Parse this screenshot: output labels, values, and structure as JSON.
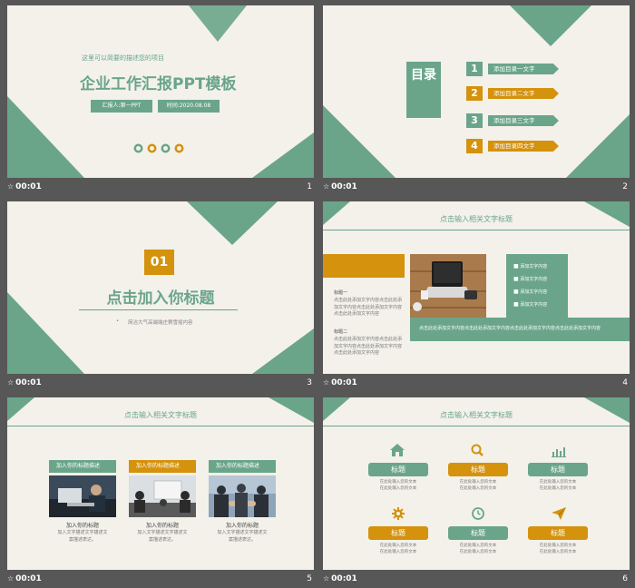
{
  "slides": [
    {
      "number": "1",
      "time": "00:01",
      "subtitle": "这里可以简要的描述您的项目",
      "title": "企业工作汇报PPT模板",
      "presenter": "汇报人:第一PPT",
      "date": "时间:2020.08.08"
    },
    {
      "number": "2",
      "time": "00:01",
      "toc_label": "目录",
      "items": [
        {
          "num": "1",
          "text": "添加目录一文字"
        },
        {
          "num": "2",
          "text": "添加目录二文字"
        },
        {
          "num": "3",
          "text": "添加目录三文字"
        },
        {
          "num": "4",
          "text": "添加目录四文字"
        }
      ]
    },
    {
      "number": "3",
      "time": "00:01",
      "section_num": "01",
      "title": "点击加入你标题",
      "desc": "简洁大气高端端庄赛雪插内容"
    },
    {
      "number": "4",
      "time": "00:01",
      "header": "点击输入相关文字标题",
      "label1": "标题一",
      "text1": "点击此处添加文字内容点击此处添加文字内容点击此处添加文字内容点击此处添加文字内容",
      "label2": "标题二",
      "text2": "点击此处添加文字内容点击此处添加文字内容点击此处添加文字内容点击此处添加文字内容",
      "bullets": [
        "添加文字内容",
        "添加文字内容",
        "添加文字内容",
        "添加文字内容"
      ],
      "bottom_text": "点击此处添加文字内容点击此处添加文字内容点击此处添加文字内容点击此处添加文字内容"
    },
    {
      "number": "5",
      "time": "00:01",
      "header": "点击输入相关文字标题",
      "cards": [
        {
          "label": "加入你的标题描述",
          "caption": "加入你的标题",
          "text": "加入文字描述文字描述文\n案描述表达。"
        },
        {
          "label": "加入你的标题描述",
          "caption": "加入你的标题",
          "text": "加入文字描述文字描述文\n案描述表达。"
        },
        {
          "label": "加入你的标题描述",
          "caption": "加入你的标题",
          "text": "加入文字描述文字描述文\n案描述表达。"
        }
      ]
    },
    {
      "number": "6",
      "time": "00:01",
      "header": "点击输入相关文字标题",
      "items": [
        {
          "icon": "home-icon",
          "title": "标题",
          "text": "在此处输入您的文本\n在此处输入您的文本"
        },
        {
          "icon": "search-icon",
          "title": "标题",
          "text": "在此处输入您的文本\n在此处输入您的文本"
        },
        {
          "icon": "bar-chart-icon",
          "title": "标题",
          "text": "在此处输入您的文本\n在此处输入您的文本"
        },
        {
          "icon": "gear-icon",
          "title": "标题",
          "text": "在此处输入您的文本\n在此处输入您的文本"
        },
        {
          "icon": "clock-icon",
          "title": "标题",
          "text": "在此处输入您的文本\n在此处输入您的文本"
        },
        {
          "icon": "send-icon",
          "title": "标题",
          "text": "在此处输入您的文本\n在此处输入您的文本"
        }
      ]
    }
  ],
  "colors": {
    "green": "#6aa58a",
    "orange": "#d4920d",
    "background": "#575757",
    "slide": "#f3f1ea"
  }
}
